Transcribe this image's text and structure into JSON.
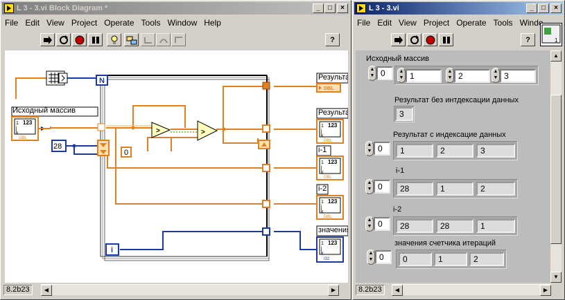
{
  "bd_window": {
    "title": "L 3 - 3.vi Block Diagram *",
    "menus": [
      "File",
      "Edit",
      "View",
      "Project",
      "Operate",
      "Tools",
      "Window",
      "Help"
    ],
    "version": "8.2b23"
  },
  "fp_window": {
    "title": "L 3 - 3.vi",
    "menus": [
      "File",
      "Edit",
      "View",
      "Project",
      "Operate",
      "Tools",
      "Windo"
    ],
    "version": "8.2b23"
  },
  "diagram": {
    "source_label": "Исходный массив",
    "out_labels": [
      "Результа",
      "Результа",
      "i-1",
      "i-2",
      "значения"
    ],
    "const_28": "28",
    "const_0": "0",
    "n_terminal": "N",
    "i_terminal": "i",
    "dbl": "DBL",
    "arr_123": "123"
  },
  "front_panel": {
    "source": {
      "label": "Исходный массив",
      "index": "0",
      "values": [
        "1",
        "2",
        "3"
      ]
    },
    "no_index": {
      "label": "Результат без интдексации данных",
      "value": "3"
    },
    "with_index": {
      "label": "Результат с индексацие данных",
      "index": "0",
      "values": [
        "1",
        "2",
        "3"
      ]
    },
    "i1": {
      "label": "i-1",
      "index": "0",
      "values": [
        "28",
        "1",
        "2"
      ]
    },
    "i2": {
      "label": "i-2",
      "index": "0",
      "values": [
        "28",
        "28",
        "1"
      ]
    },
    "iter": {
      "label": "значения счетчика итераций",
      "index": "0",
      "values": [
        "0",
        "1",
        "2"
      ]
    }
  }
}
